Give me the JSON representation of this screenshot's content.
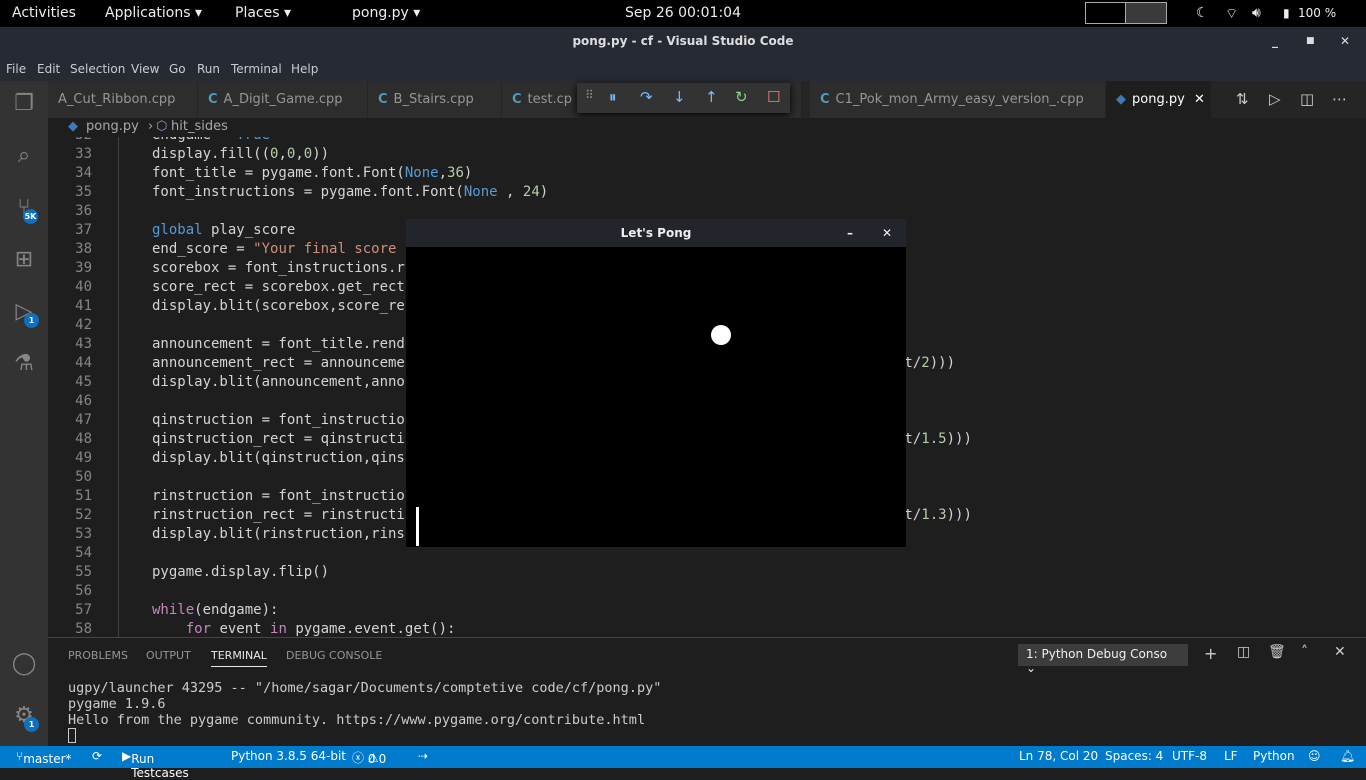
{
  "topbar": {
    "activities": "Activities",
    "applications": "Applications",
    "places": "Places",
    "app": "pong.py",
    "clock": "Sep 26  00:01:04",
    "battery": "100 %"
  },
  "window": {
    "title": "pong.py - cf - Visual Studio Code"
  },
  "menu": [
    "File",
    "Edit",
    "Selection",
    "View",
    "Go",
    "Run",
    "Terminal",
    "Help"
  ],
  "activity_badges": {
    "scm": "5K",
    "debug": "1",
    "settings": "1"
  },
  "tabs": [
    {
      "label": "A_Cut_Ribbon.cpp"
    },
    {
      "label": "A_Digit_Game.cpp"
    },
    {
      "label": "B_Stairs.cpp"
    },
    {
      "label": "test.cp"
    },
    {
      "label": "C1_Pok_mon_Army_easy_version_.cpp"
    },
    {
      "label": "pong.py",
      "active": true
    }
  ],
  "breadcrumb": {
    "file": "pong.py",
    "symbol": "hit_sides"
  },
  "code": [
    {
      "n": "32",
      "t": [
        [
          "endgame = ",
          ""
        ],
        [
          "True",
          "b"
        ]
      ]
    },
    {
      "n": "33",
      "t": [
        [
          "display.fill((",
          ""
        ],
        [
          "0",
          "n"
        ],
        [
          ",",
          ""
        ],
        [
          "0",
          "n"
        ],
        [
          ",",
          ""
        ],
        [
          "0",
          "n"
        ],
        [
          "))",
          ""
        ]
      ]
    },
    {
      "n": "34",
      "t": [
        [
          "font_title = pygame.font.Font(",
          ""
        ],
        [
          "None",
          "b"
        ],
        [
          ",",
          ""
        ],
        [
          "36",
          "n"
        ],
        [
          ")",
          ""
        ]
      ]
    },
    {
      "n": "35",
      "t": [
        [
          "font_instructions = pygame.font.Font(",
          ""
        ],
        [
          "None",
          "b"
        ],
        [
          " , ",
          ""
        ],
        [
          "24",
          "n"
        ],
        [
          ")",
          ""
        ]
      ]
    },
    {
      "n": "36",
      "t": []
    },
    {
      "n": "37",
      "t": [
        [
          "global",
          "b"
        ],
        [
          " play_score",
          ""
        ]
      ]
    },
    {
      "n": "38",
      "t": [
        [
          "end_score = ",
          ""
        ],
        [
          "\"Your final score ",
          "s"
        ]
      ]
    },
    {
      "n": "39",
      "t": [
        [
          "scorebox = font_instructions.r",
          ""
        ]
      ]
    },
    {
      "n": "40",
      "t": [
        [
          "score_rect = scorebox.get_rect",
          ""
        ]
      ]
    },
    {
      "n": "41",
      "t": [
        [
          "display.blit(scorebox,score_re",
          ""
        ]
      ]
    },
    {
      "n": "42",
      "t": []
    },
    {
      "n": "43",
      "t": [
        [
          "announcement = font_title.rend",
          ""
        ]
      ]
    },
    {
      "n": "44",
      "t": [
        [
          "announcement_rect = announceme",
          ""
        ]
      ],
      "tail": [
        [
          "nt/",
          ""
        ],
        [
          "2",
          "n"
        ],
        [
          ")))",
          ""
        ]
      ]
    },
    {
      "n": "45",
      "t": [
        [
          "display.blit(announcement,anno",
          ""
        ]
      ]
    },
    {
      "n": "46",
      "t": []
    },
    {
      "n": "47",
      "t": [
        [
          "qinstruction = font_instructio",
          ""
        ]
      ]
    },
    {
      "n": "48",
      "t": [
        [
          "qinstruction_rect = qinstructi",
          ""
        ]
      ],
      "tail": [
        [
          "nt/",
          ""
        ],
        [
          "1.5",
          "n"
        ],
        [
          ")))",
          ""
        ]
      ]
    },
    {
      "n": "49",
      "t": [
        [
          "display.blit(qinstruction,qins",
          ""
        ]
      ]
    },
    {
      "n": "50",
      "t": []
    },
    {
      "n": "51",
      "t": [
        [
          "rinstruction = font_instructio",
          ""
        ]
      ]
    },
    {
      "n": "52",
      "t": [
        [
          "rinstruction_rect = rinstructi",
          ""
        ]
      ],
      "tail": [
        [
          "nt/",
          ""
        ],
        [
          "1.3",
          "n"
        ],
        [
          ")))",
          ""
        ]
      ]
    },
    {
      "n": "53",
      "t": [
        [
          "display.blit(rinstruction,rins",
          ""
        ]
      ]
    },
    {
      "n": "54",
      "t": []
    },
    {
      "n": "55",
      "t": [
        [
          "pygame.display.flip()",
          ""
        ]
      ]
    },
    {
      "n": "56",
      "t": []
    },
    {
      "n": "57",
      "t": [
        [
          "while",
          "k"
        ],
        [
          "(endgame):",
          ""
        ]
      ]
    },
    {
      "n": "58",
      "t": [
        [
          "    ",
          ""
        ],
        [
          "for",
          "k"
        ],
        [
          " event ",
          ""
        ],
        [
          "in",
          "k"
        ],
        [
          " pygame.event.get():",
          ""
        ]
      ]
    }
  ],
  "pong": {
    "title": "Let's Pong"
  },
  "panel": {
    "tabs": [
      "PROBLEMS",
      "OUTPUT",
      "TERMINAL",
      "DEBUG CONSOLE"
    ],
    "active": "TERMINAL",
    "terminal_select": "1: Python Debug Conso"
  },
  "terminal": [
    "ugpy/launcher 43295 -- \"/home/sagar/Documents/comptetive code/cf/pong.py\"",
    "pygame 1.9.6",
    "Hello from the pygame community. https://www.pygame.org/contribute.html"
  ],
  "status": {
    "branch": "master*",
    "run": "Run Testcases",
    "python": "Python 3.8.5 64-bit",
    "errors": "0",
    "warnings": "0",
    "position": "Ln 78, Col 20",
    "spaces": "Spaces: 4",
    "encoding": "UTF-8",
    "eol": "LF",
    "language": "Python"
  },
  "colors": {
    "statusbar": "#007acc",
    "editor": "#1e1e1e"
  }
}
